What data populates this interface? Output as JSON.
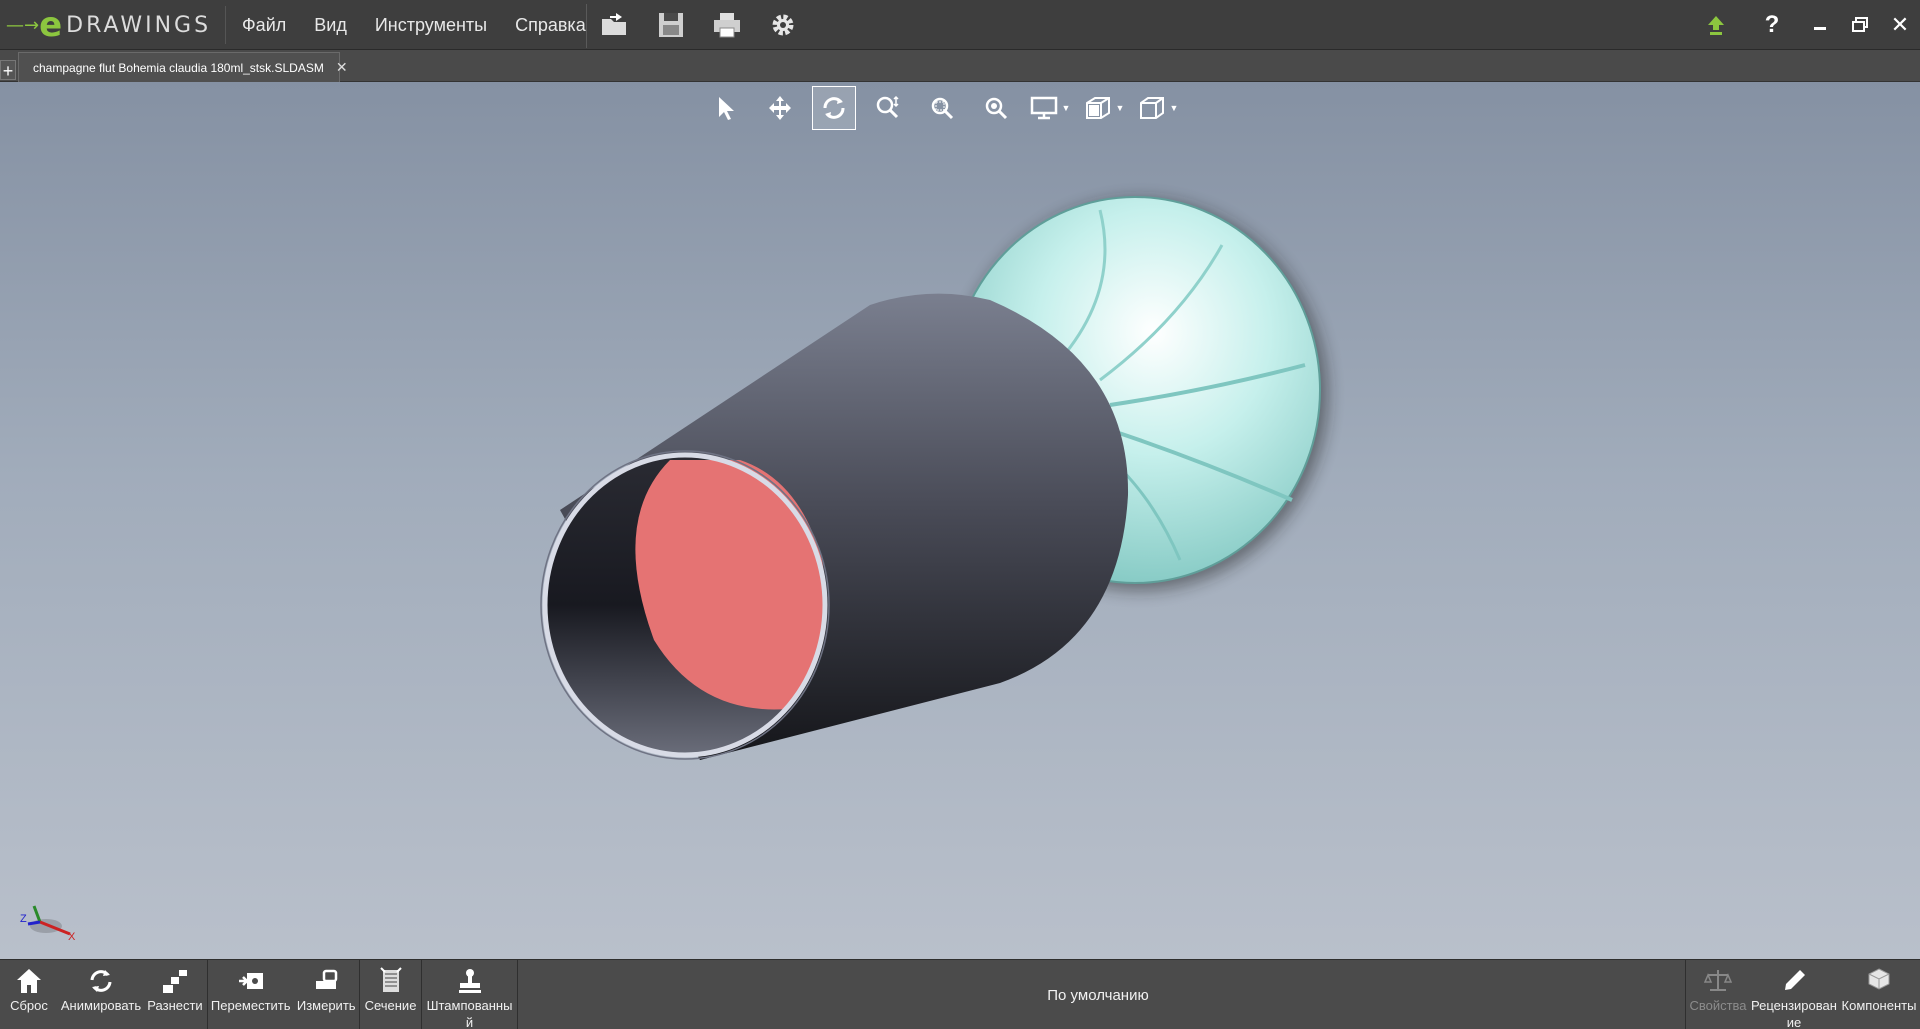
{
  "app": {
    "logo_text": "DRAWINGS",
    "logo_letter": "e"
  },
  "menu": {
    "items": [
      "Файл",
      "Вид",
      "Инструменты",
      "Справка"
    ]
  },
  "quick_tools": [
    {
      "icon": "open-folder-icon"
    },
    {
      "icon": "save-icon"
    },
    {
      "icon": "print-icon"
    },
    {
      "icon": "gear-icon"
    }
  ],
  "top_right": {
    "upload_icon": "upload-arrow-icon",
    "help_glyph": "?",
    "minimize_icon": "minimize-icon",
    "restore_icon": "restore-icon",
    "close_glyph": "✕"
  },
  "tabs": {
    "add_glyph": "+",
    "active": {
      "label": "champagne flut Bohemia claudia 180ml_stsk.SLDASM",
      "close_glyph": "✕"
    }
  },
  "view_toolbar": [
    {
      "icon": "select-arrow-icon"
    },
    {
      "icon": "pan-icon"
    },
    {
      "icon": "rotate-icon",
      "active": true
    },
    {
      "icon": "zoom-icon"
    },
    {
      "icon": "zoom-to-area-icon"
    },
    {
      "icon": "zoom-to-fit-icon"
    },
    {
      "icon": "display-style-icon",
      "dropdown": true
    },
    {
      "icon": "section-view-icon",
      "dropdown": true
    },
    {
      "icon": "view-orientation-icon",
      "dropdown": true
    }
  ],
  "bottom_toolbar": {
    "group1": [
      {
        "icon": "home-icon",
        "label": "Сброс"
      },
      {
        "icon": "animate-icon",
        "label": "Анимировать"
      },
      {
        "icon": "explode-icon",
        "label": "Разнести"
      }
    ],
    "group2": [
      {
        "icon": "move-icon",
        "label": "Переместить"
      },
      {
        "icon": "measure-icon",
        "label": "Измерить"
      }
    ],
    "group3": [
      {
        "icon": "section-icon",
        "label": "Сечение"
      }
    ],
    "group4": [
      {
        "icon": "stamp-icon",
        "label_line1": "Штампованны",
        "label_line2": "й"
      }
    ],
    "center_label": "По умолчанию",
    "right": [
      {
        "icon": "properties-icon",
        "label": "Свойства",
        "disabled": true
      },
      {
        "icon": "review-icon",
        "label_line1": "Рецензирован",
        "label_line2": "ие"
      },
      {
        "icon": "components-icon",
        "label": "Компоненты"
      }
    ]
  },
  "triad": {
    "x_label": "X",
    "z_label": "Z"
  },
  "colors": {
    "accent_green": "#8cc63f",
    "viewport_top": "#8591a3",
    "viewport_bottom": "#b9c0cb",
    "cylinder_dark": "#1b1c22",
    "cylinder_light": "#7a7f8f",
    "face_red": "#e57373",
    "flute_cyan": "#a9e3de"
  }
}
